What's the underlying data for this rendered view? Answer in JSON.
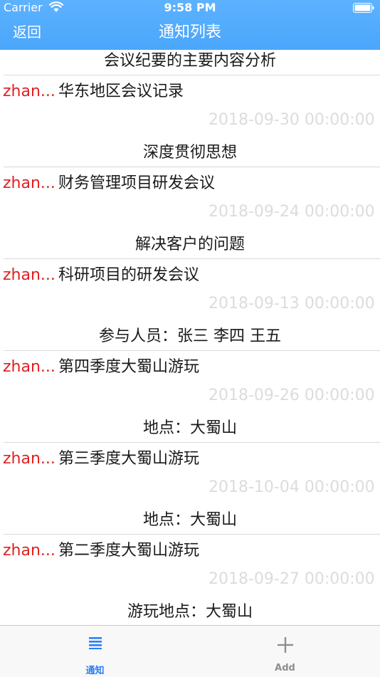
{
  "status_bar": {
    "carrier": "Carrier",
    "time": "9:58 PM"
  },
  "nav": {
    "back_label": "返回",
    "title": "通知列表"
  },
  "colors": {
    "nav_background": "#4aa6fb",
    "sender_red": "#e02020",
    "date_gray": "#dcdcdc",
    "tab_active": "#2a7ff6",
    "tab_inactive": "#8e8e93"
  },
  "notices": [
    {
      "summary": "会议纪要的主要内容分析",
      "sender": "zhan...",
      "title": "华东地区会议记录",
      "date": "2018-09-30 00:00:00"
    },
    {
      "summary": "深度贯彻思想",
      "sender": "zhan...",
      "title": "财务管理项目研发会议",
      "date": "2018-09-24 00:00:00"
    },
    {
      "summary": "解决客户的问题",
      "sender": "zhan...",
      "title": "科研项目的研发会议",
      "date": "2018-09-13 00:00:00"
    },
    {
      "summary": "参与人员：张三 李四 王五",
      "sender": "zhan...",
      "title": "第四季度大蜀山游玩",
      "date": "2018-09-26 00:00:00"
    },
    {
      "summary": "地点：大蜀山",
      "sender": "zhan...",
      "title": "第三季度大蜀山游玩",
      "date": "2018-10-04 00:00:00"
    },
    {
      "summary": "地点：大蜀山",
      "sender": "zhan...",
      "title": "第二季度大蜀山游玩",
      "date": "2018-09-27 00:00:00"
    },
    {
      "summary": "游玩地点：大蜀山"
    }
  ],
  "tabs": [
    {
      "label": "通知",
      "icon": "list-icon",
      "active": true
    },
    {
      "label": "Add",
      "icon": "plus-icon",
      "active": false
    }
  ]
}
